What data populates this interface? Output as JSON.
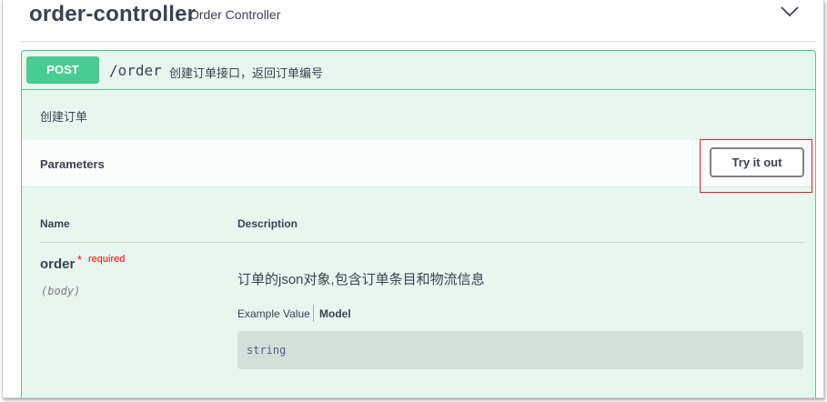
{
  "tag": {
    "title": "order-controller",
    "description": "Order Controller"
  },
  "operation": {
    "method": "POST",
    "path": "/order",
    "summary": "创建订单接口，返回订单编号",
    "description": "创建订单",
    "method_color": "#49cc90"
  },
  "parameters": {
    "title": "Parameters",
    "try_label": "Try it out",
    "columns": {
      "name": "Name",
      "description": "Description"
    },
    "items": [
      {
        "name": "order",
        "required_marker": "*",
        "required_label": "required",
        "in": "(body)",
        "description": "订单的json对象,包含订单条目和物流信息",
        "tabs": {
          "example": "Example Value",
          "model": "Model"
        },
        "example_value": "string"
      }
    ]
  },
  "icons": {
    "collapse": "chevron-down-icon"
  },
  "colors": {
    "highlight": "#e02020",
    "required": "#ff0000"
  }
}
